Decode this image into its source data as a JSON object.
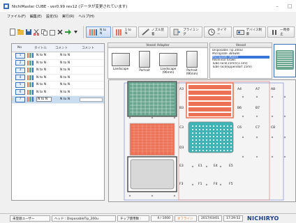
{
  "window": {
    "title": "NichiMaster CUBE - ver0.99 rev12 (データが変更されています)"
  },
  "menu": {
    "items": [
      "ファイル(F)",
      "編集(E)",
      "設定(S)",
      "実行(R)",
      "ヘルプ(H)"
    ]
  },
  "toolbar": {
    "buttons": [
      {
        "label": "N to N"
      },
      {
        "label": "1 to N"
      },
      {
        "label": "ノズル装着"
      },
      {
        "label": "プライミング"
      },
      {
        "label": "タイマー"
      },
      {
        "label": "デバイス制御"
      },
      {
        "label": "一時停止"
      }
    ]
  },
  "protocol_list": {
    "headers": [
      "No",
      "タイトル",
      "コメント",
      "コメント"
    ],
    "rows": [
      {
        "no": "1",
        "title": "N to N",
        "comment": "N to N"
      },
      {
        "no": "2",
        "title": "N to N",
        "comment": "N to N"
      },
      {
        "no": "3",
        "title": "N to N",
        "comment": "N to N"
      },
      {
        "no": "4",
        "title": "N to N",
        "comment": "N to N"
      },
      {
        "no": "5",
        "title": "N to N",
        "comment": "N to N"
      },
      {
        "no": "6",
        "title": "N to N",
        "comment": "N to N"
      },
      {
        "no": "7",
        "title": "N to N",
        "comment": "N to N"
      }
    ]
  },
  "vessel_adapter": {
    "title": "Vessel Adapter",
    "options": [
      {
        "label": "Landscape"
      },
      {
        "label": "Portrait"
      },
      {
        "label": "Landscape (96mm)"
      },
      {
        "label": "Portrait (96mm)"
      }
    ]
  },
  "vessel": {
    "title": "Vessel",
    "items": [
      "Disposable Tip 200ul",
      "Microplate 384well",
      "Microplate 96well",
      "Reservoir 6rows",
      "Tube rack(15ml)/(1.5ml)",
      "Tube rack(Eppendorf 15ml)"
    ],
    "selected_index": 2
  },
  "deck": {
    "slots_col_a": [
      "A3",
      "B3",
      "C3",
      "D3",
      "E3",
      "F3"
    ],
    "slots_col_b": [
      "A4",
      "A7",
      "A8",
      "B6",
      "B7",
      "C6",
      "C7",
      "C8",
      "E1",
      "E4",
      "E5",
      "F1",
      "F4",
      "F5"
    ]
  },
  "status": {
    "user": "未登録ユーザー",
    "head": "ヘッド : DisposableTip_200u",
    "tip": "チップ使用数 :",
    "count": "4 / 1000",
    "mode": "オフライン",
    "date": "2017/03/01",
    "time": "17:29:52",
    "logo": "NICHIRYO"
  },
  "colors": {
    "green": "#6aa590",
    "red": "#ec7155",
    "cyan": "#3fb3b5",
    "accent": "#3a70b8"
  }
}
